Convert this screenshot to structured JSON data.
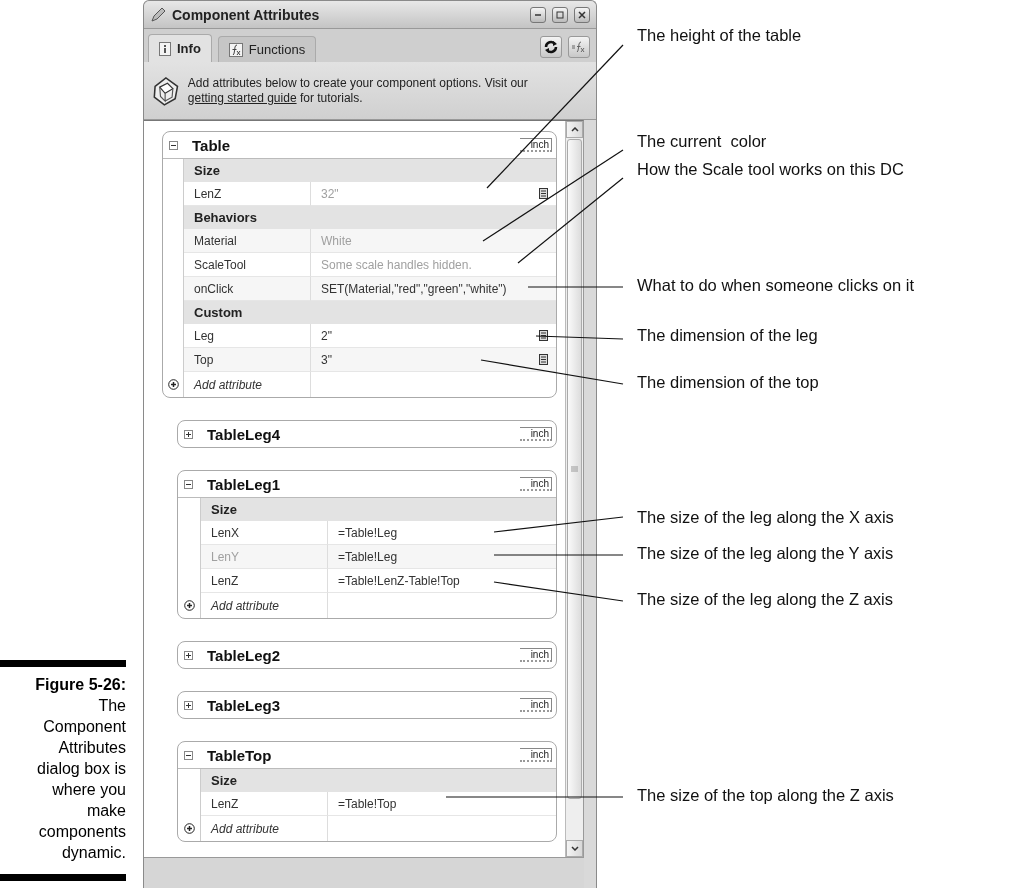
{
  "figure_caption": {
    "label": "Figure 5-26:",
    "text": "The Component Attributes dialog box is where you make components dynamic."
  },
  "window": {
    "title": "Component Attributes"
  },
  "tabs": [
    {
      "label": "Info",
      "selected": true
    },
    {
      "label": "Functions",
      "selected": false
    }
  ],
  "info": {
    "text_before": "Add attributes below to create your component options. Visit our ",
    "link": "getting started guide",
    "text_after": " for tutorials."
  },
  "groups": [
    {
      "name": "Table",
      "expanded": true,
      "unit": "inch",
      "sections": [
        {
          "heading": "Size",
          "rows": [
            {
              "label": "LenZ",
              "value": "32\"",
              "label_greyed": false,
              "value_greyed": true,
              "picker": true
            }
          ]
        },
        {
          "heading": "Behaviors",
          "rows": [
            {
              "label": "Material",
              "value": "White",
              "label_greyed": false,
              "value_greyed": true,
              "picker": false
            },
            {
              "label": "ScaleTool",
              "value": "Some scale handles hidden.",
              "label_greyed": false,
              "value_greyed": true,
              "picker": false
            },
            {
              "label": "onClick",
              "value": "SET(Material,\"red\",\"green\",\"white\")",
              "label_greyed": false,
              "value_greyed": false,
              "picker": false
            }
          ]
        },
        {
          "heading": "Custom",
          "rows": [
            {
              "label": "Leg",
              "value": "2\"",
              "label_greyed": false,
              "value_greyed": false,
              "picker": true
            },
            {
              "label": "Top",
              "value": "3\"",
              "label_greyed": false,
              "value_greyed": false,
              "picker": true
            }
          ]
        }
      ],
      "add_label": "Add attribute"
    },
    {
      "name": "TableLeg4",
      "expanded": false,
      "unit": "inch"
    },
    {
      "name": "TableLeg1",
      "expanded": true,
      "unit": "inch",
      "sections": [
        {
          "heading": "Size",
          "rows": [
            {
              "label": "LenX",
              "value": "=Table!Leg",
              "label_greyed": false,
              "value_greyed": false,
              "picker": false
            },
            {
              "label": "LenY",
              "value": "=Table!Leg",
              "label_greyed": true,
              "value_greyed": false,
              "picker": false
            },
            {
              "label": "LenZ",
              "value": "=Table!LenZ-Table!Top",
              "label_greyed": false,
              "value_greyed": false,
              "picker": false
            }
          ]
        }
      ],
      "add_label": "Add attribute"
    },
    {
      "name": "TableLeg2",
      "expanded": false,
      "unit": "inch"
    },
    {
      "name": "TableLeg3",
      "expanded": false,
      "unit": "inch"
    },
    {
      "name": "TableTop",
      "expanded": true,
      "unit": "inch",
      "sections": [
        {
          "heading": "Size",
          "rows": [
            {
              "label": "LenZ",
              "value": "=Table!Top",
              "label_greyed": false,
              "value_greyed": false,
              "picker": false
            }
          ]
        }
      ],
      "add_label": "Add attribute"
    }
  ],
  "callouts": [
    {
      "text": "The height of the table"
    },
    {
      "text": "The current  color"
    },
    {
      "text": "How the Scale tool works on this DC"
    },
    {
      "text": "What to do when someone clicks on it"
    },
    {
      "text": "The dimension of the leg"
    },
    {
      "text": "The dimension of the top"
    },
    {
      "text": "The size of the leg along the X axis"
    },
    {
      "text": "The size of the leg along the Y axis"
    },
    {
      "text": "The size of the leg along the Z axis"
    },
    {
      "text": "The size of the top along the Z axis"
    }
  ]
}
